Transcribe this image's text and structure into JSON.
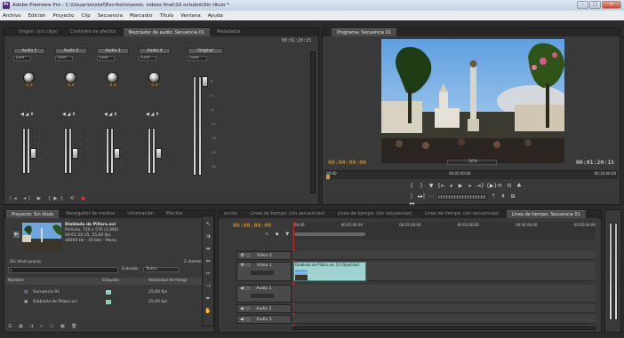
{
  "window": {
    "title": "Adobe Premiere Pro - C:\\Usuarios\\stef\\Escritorio\\sesio. videos final\\10 octubre\\Sin título *",
    "icon": "Pr",
    "buttons": [
      "–",
      "□",
      "✕"
    ]
  },
  "menu": [
    "Archivo",
    "Edición",
    "Proyecto",
    "Clip",
    "Secuencia",
    "Marcador",
    "Título",
    "Ventana",
    "Ayuda"
  ],
  "top_left_panel": {
    "tabs": [
      "Origen: (sin clips)",
      "Controles de efectos",
      "Mezclador de audio: Secuencia 01",
      "Metadatos"
    ],
    "timecode": "00:01:20:15",
    "tracks": [
      {
        "label": "Audio 1",
        "mode": "Leer",
        "value": "0.0"
      },
      {
        "label": "Audio 2",
        "mode": "Leer",
        "value": "0.0"
      },
      {
        "label": "Audio 3",
        "mode": "Leer",
        "value": "0.0"
      },
      {
        "label": "Audio 4",
        "mode": "Leer",
        "value": "0.0"
      }
    ],
    "master": {
      "label": "Original",
      "mode": "Leer"
    },
    "meter_scale": [
      "6",
      "0",
      "-6",
      "-12",
      "-18",
      "-24",
      "-36"
    ]
  },
  "program_monitor": {
    "tab": "Programa: Secuencia 01",
    "timecode_left": "00:00:00:00",
    "fit": "50%",
    "timecode_right": "00:01:20:15",
    "ruler_left": "00:00",
    "ruler_mid": "00:05:00:00",
    "ruler_right": "00:10:00:00"
  },
  "project_panel": {
    "tabs": [
      "Proyecto: Sin título",
      "Navegador de medios",
      "Información",
      "Efectos"
    ],
    "clip_name": "Diablada de Pillaro.avi",
    "clip_info": [
      "Película, 720 x 576 (1,094)",
      "00:01:20:15, 25,00 fps",
      "48000 Hz - 16 bits - Mono"
    ],
    "project_name": "Sin título.prproj",
    "item_count": "2 elementos",
    "search_in_label": "Entrada:",
    "search_in_value": "Todos",
    "columns": [
      "Nombre",
      "Etiqueta",
      "Velocidad de fotogr"
    ],
    "items": [
      {
        "name": "Secuencia 01",
        "rate": "25,00 fps",
        "label_color": "#8fd0c8"
      },
      {
        "name": "Diablada de Pillaro.avi",
        "rate": "25,00 fps",
        "label_color": "#8fd0b0"
      }
    ]
  },
  "timeline": {
    "tabs": [
      "encia)",
      "Línea de tiempo: (sin secuencias)",
      "Línea de tiempo: (sin secuencias)",
      "Línea de tiempo: (sin secuencias)",
      "Línea de tiempo: Secuencia 01"
    ],
    "timecode": "00:00:00:00",
    "ruler": [
      "00:00",
      "00:01:00:00",
      "00:02:00:00",
      "00:03:00:00",
      "00:04:00:00",
      "00:05:00:00"
    ],
    "tracks": [
      {
        "label": "Vídeo 2",
        "kind": "video"
      },
      {
        "label": "Vídeo 1",
        "kind": "video"
      },
      {
        "label": "Audio 1",
        "kind": "audio"
      },
      {
        "label": "Audio 2",
        "kind": "audio"
      },
      {
        "label": "Audio 3",
        "kind": "audio"
      }
    ],
    "clip_label": "Diablada de Pillaro.avi [V] Opacidad"
  }
}
